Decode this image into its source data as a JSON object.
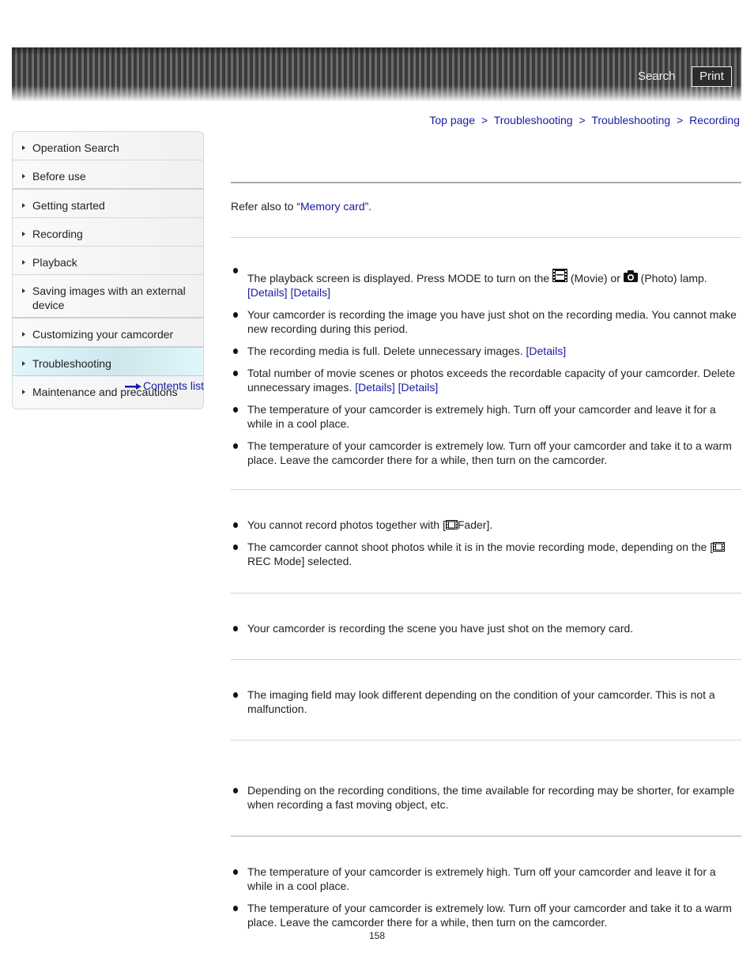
{
  "header": {
    "search_label": "Search",
    "print_label": "Print"
  },
  "breadcrumb": [
    {
      "label": "Top page"
    },
    {
      "label": "Troubleshooting"
    },
    {
      "label": "Troubleshooting"
    },
    {
      "label": "Recording"
    }
  ],
  "breadcrumb_separator": ">",
  "sidebar": {
    "items": [
      {
        "label": "Operation Search"
      },
      {
        "label": "Before use"
      },
      {
        "label": "Getting started"
      },
      {
        "label": "Recording"
      },
      {
        "label": "Playback"
      },
      {
        "label": "Saving images with an external device"
      },
      {
        "label": "Customizing your camcorder"
      },
      {
        "label": "Troubleshooting",
        "active": true
      },
      {
        "label": "Maintenance and precautions"
      }
    ],
    "contents_list_label": "Contents list"
  },
  "main": {
    "refer": {
      "prefix": "Refer also to “",
      "link": "Memory card",
      "suffix": "”."
    },
    "details_label": "[Details]",
    "section1": {
      "item1": {
        "part1": "The playback screen is displayed. Press MODE to turn on the ",
        "part2": " (Movie) or ",
        "part3": " (Photo) lamp."
      },
      "item2": "Your camcorder is recording the image you have just shot on the recording media. You cannot make new recording during this period.",
      "item3": "The recording media is full. Delete unnecessary images. ",
      "item4": "Total number of movie scenes or photos exceeds the recordable capacity of your camcorder. Delete unnecessary images. ",
      "item5": "The temperature of your camcorder is extremely high. Turn off your camcorder and leave it for a while in a cool place.",
      "item6": "The temperature of your camcorder is extremely low. Turn off your camcorder and take it to a warm place. Leave the camcorder there for a while, then turn on the camcorder."
    },
    "section2": {
      "item1": {
        "part1": "You cannot record photos together with [",
        "part2": "Fader]."
      },
      "item2": {
        "part1": "The camcorder cannot shoot photos while it is in the movie recording mode, depending on the [",
        "part2": " REC Mode] selected."
      }
    },
    "section3": {
      "item1": "Your camcorder is recording the scene you have just shot on the memory card."
    },
    "section4": {
      "item1": "The imaging field may look different depending on the condition of your camcorder. This is not a malfunction."
    },
    "section5": {
      "item1": "Depending on the recording conditions, the time available for recording may be shorter, for example when recording a fast moving object, etc."
    },
    "section6": {
      "item1": "The temperature of your camcorder is extremely high. Turn off your camcorder and leave it for a while in a cool place.",
      "item2": "The temperature of your camcorder is extremely low. Turn off your camcorder and take it to a warm place. Leave the camcorder there for a while, then turn on the camcorder."
    }
  },
  "footer": {
    "page_number": "158"
  },
  "colors": {
    "link": "#1a1aa6",
    "active_nav": "#dff6fb",
    "header_dark": "#3a3a3a"
  }
}
